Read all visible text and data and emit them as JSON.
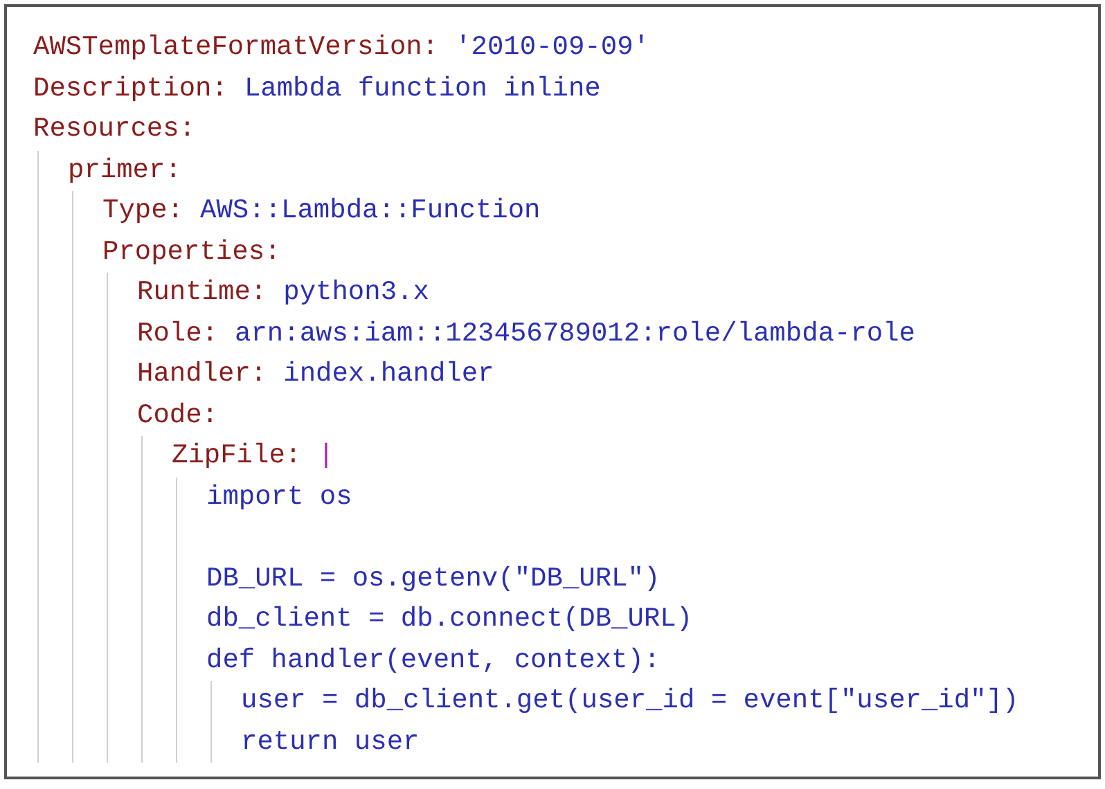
{
  "lines": [
    {
      "kind": "pair",
      "key": "AWSTemplateFormatVersion:",
      "value": "'2010-09-09'"
    },
    {
      "kind": "pair",
      "key": "Description:",
      "value": "Lambda function inline"
    },
    {
      "kind": "pair",
      "key": "Resources:",
      "children": [
        {
          "kind": "pair",
          "key": "primer:",
          "children": [
            {
              "kind": "pair",
              "key": "Type:",
              "value": "AWS::Lambda::Function"
            },
            {
              "kind": "pair",
              "key": "Properties:",
              "children": [
                {
                  "kind": "pair",
                  "key": "Runtime:",
                  "value": "python3.x"
                },
                {
                  "kind": "pair",
                  "key": "Role:",
                  "value": "arn:aws:iam::123456789012:role/lambda-role"
                },
                {
                  "kind": "pair",
                  "key": "Handler:",
                  "value": "index.handler"
                },
                {
                  "kind": "pair",
                  "key": "Code:",
                  "children": [
                    {
                      "kind": "block_scalar",
                      "key": "ZipFile:",
                      "value": "|",
                      "children": [
                        {
                          "kind": "code",
                          "text": "import os"
                        },
                        {
                          "kind": "blank"
                        },
                        {
                          "kind": "code",
                          "text": "DB_URL = os.getenv(\"DB_URL\")"
                        },
                        {
                          "kind": "code",
                          "text": "db_client = db.connect(DB_URL)"
                        },
                        {
                          "kind": "code",
                          "text": "def handler(event, context):",
                          "children": [
                            {
                              "kind": "code",
                              "text": "user = db_client.get(user_id = event[\"user_id\"])"
                            },
                            {
                              "kind": "code",
                              "text": "return user"
                            }
                          ]
                        }
                      ]
                    }
                  ]
                }
              ]
            }
          ]
        }
      ]
    }
  ]
}
